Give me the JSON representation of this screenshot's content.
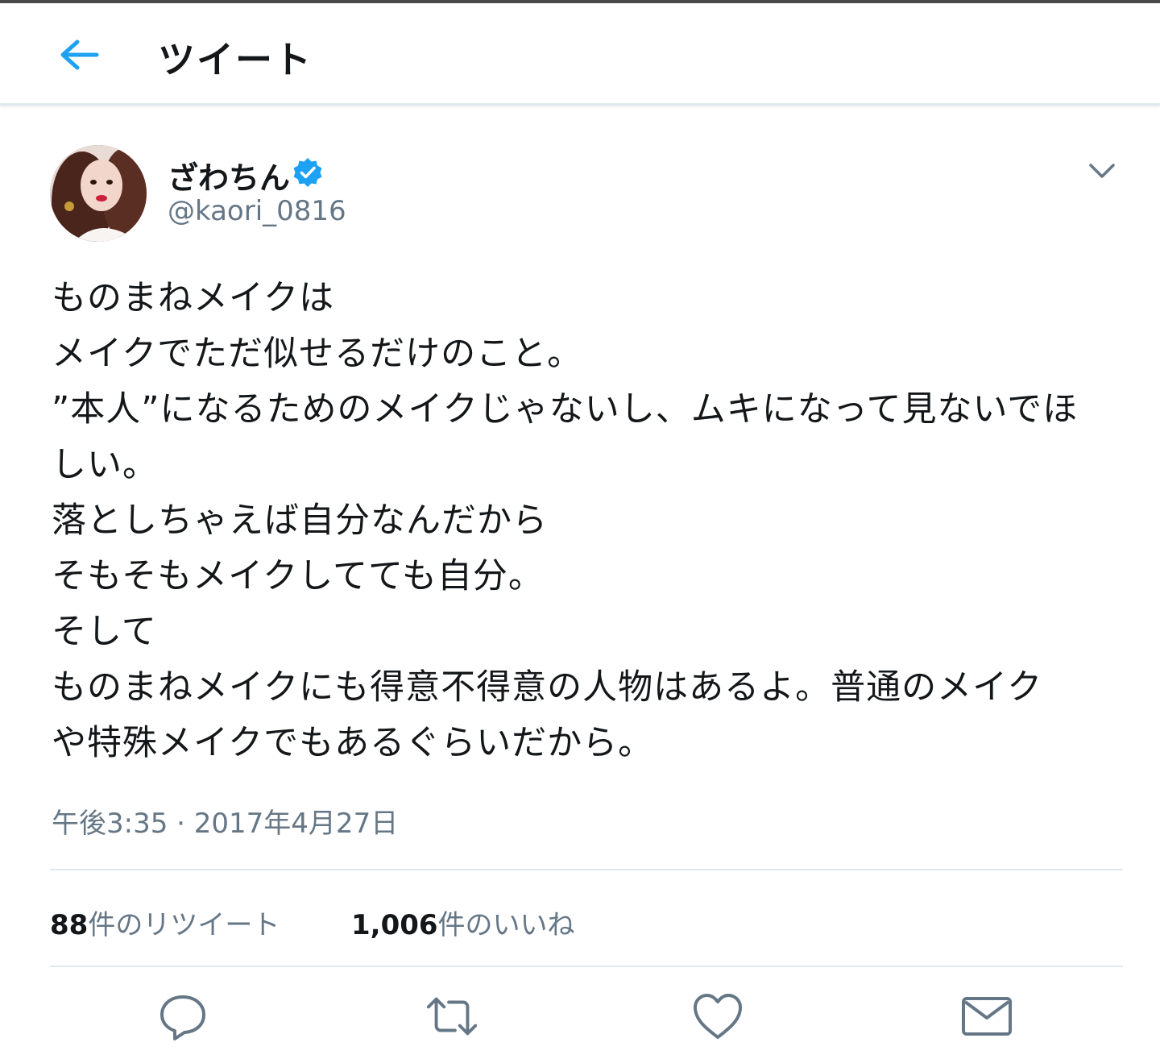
{
  "header": {
    "title": "ツイート",
    "back_icon": "arrow-left-icon",
    "accent": "#1da1f2"
  },
  "tweet": {
    "display_name": "ざわちん",
    "verified": true,
    "handle": "@kaori_0816",
    "lines": [
      "ものまねメイクは",
      "メイクでただ似せるだけのこと。",
      "”本人”になるためのメイクじゃないし、ムキになって見ないでほ",
      "しい。",
      "落としちゃえば自分なんだから",
      "そもそもメイクしてても自分。",
      "そして",
      "ものまねメイクにも得意不得意の人物はあるよ。普通のメイク",
      "や特殊メイクでもあるぐらいだから。"
    ],
    "timestamp": "午後3:35 · 2017年4月27日"
  },
  "stats": {
    "retweets_count": "88",
    "retweets_label": "件のリツイート",
    "likes_count": "1,006",
    "likes_label": "件のいいね"
  },
  "actions": [
    "reply-icon",
    "retweet-icon",
    "like-icon",
    "share-icon"
  ],
  "colors": {
    "text": "#14171a",
    "secondary": "#657786",
    "divider": "#e1e8ed",
    "icon": "#657786"
  }
}
